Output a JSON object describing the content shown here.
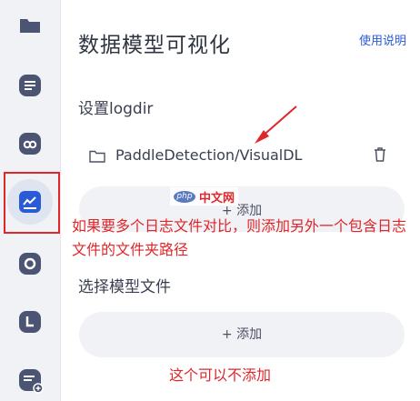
{
  "app": {
    "title": "数据模型可视化",
    "help_link": "使用说明"
  },
  "sidebar": {
    "items": [
      {
        "icon": "folder-icon"
      },
      {
        "icon": "document-list-icon"
      },
      {
        "icon": "cloud-link-icon"
      },
      {
        "icon": "chart-icon",
        "active": true
      },
      {
        "icon": "circle-icon"
      },
      {
        "icon": "corner-icon"
      },
      {
        "icon": "add-list-icon"
      }
    ],
    "accent": "#2a5bd7"
  },
  "logdir": {
    "label": "设置logdir",
    "path": "PaddleDetection/VisualDL",
    "add_label": "+ 添加"
  },
  "model": {
    "label": "选择模型文件",
    "add_label": "+ 添加"
  },
  "annotations": {
    "logdir_note": "如果要多个日志文件对比，则添加另外一个包含日志文件的文件夹路径",
    "model_note": "这个可以不添加",
    "color": "#e0262a"
  },
  "watermark": {
    "logo": "php",
    "text": "中文网"
  }
}
